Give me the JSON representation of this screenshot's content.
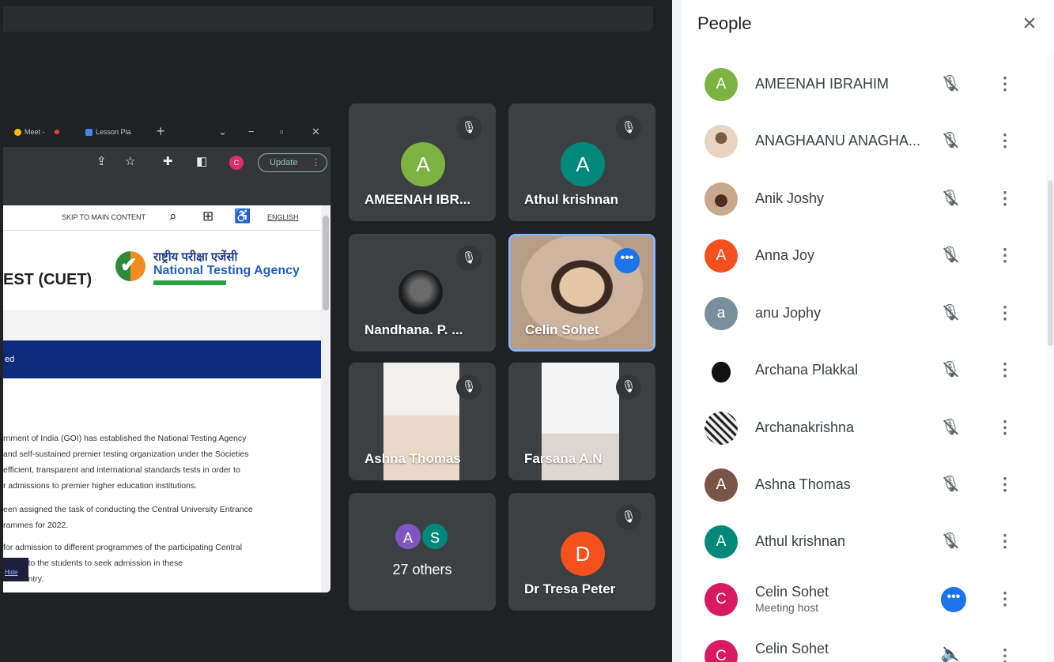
{
  "colors": {
    "meet_bg": "#202124",
    "tile_bg": "#3c4043",
    "accent_blue": "#1a73e8",
    "speaking_border": "#8ab4f8"
  },
  "shared_screen": {
    "browser": {
      "tabs": [
        "Meet -",
        "Lesson Pla"
      ],
      "new_tab_icon": "plus-icon",
      "update_label": "Update",
      "profile_initial": "C"
    },
    "site": {
      "skip_link": "SKIP TO MAIN CONTENT",
      "english_link": "ENGLISH",
      "title_fragment": "EST (CUET)",
      "agency_hindi": "राष्ट्रीय परीक्षा एजेंसी",
      "agency_name": "National Testing Agency",
      "banner_fragment": "ed",
      "paragraphs": [
        "rnment of India (GOI) has established the National Testing Agency\n and self-sustained premier testing organization under the Societies\nefficient, transparent and international standards tests in order to\nr admissions to premier higher education institutions.",
        "een assigned the task of conducting the Central University Entrance\nrammes for 2022.",
        " for admission to different programmes of the participating Central\n      rtunity to the students to seek admission in these\n      ne country."
      ],
      "hide_label": "Hide"
    }
  },
  "tiles": [
    {
      "name": "AMEENAH IBR...",
      "initial": "A",
      "color": "#7cb342",
      "muted": true
    },
    {
      "name": "Athul krishnan",
      "initial": "A",
      "color": "#00897b",
      "muted": true
    },
    {
      "name": "Nandhana. P. ...",
      "muted": true
    },
    {
      "name": "Celin Sohet",
      "speaking": true
    },
    {
      "name": "Ashna Thomas",
      "muted": true
    },
    {
      "name": "Farsana A.N",
      "muted": true
    },
    {
      "others_label": "27 others",
      "initials": [
        "A",
        "S"
      ],
      "colors": [
        "#7e57c2",
        "#00897b"
      ]
    },
    {
      "name": "Dr Tresa Peter",
      "initial": "D",
      "color": "#f4511e",
      "muted": true
    }
  ],
  "people_panel": {
    "title": "People",
    "close_icon": "close-icon",
    "participants": [
      {
        "name": "AMEENAH IBRAHIM",
        "initial": "A",
        "color": "#7cb342",
        "status": "muted"
      },
      {
        "name": "ANAGHAANU ANAGHA...",
        "photo": true,
        "color": "#e8d4c0",
        "status": "muted"
      },
      {
        "name": "Anik Joshy",
        "photo": true,
        "color": "#c9a98e",
        "status": "muted"
      },
      {
        "name": "Anna Joy",
        "initial": "A",
        "color": "#f4511e",
        "status": "muted"
      },
      {
        "name": "anu Jophy",
        "initial": "a",
        "color": "#78909c",
        "status": "muted"
      },
      {
        "name": "Archana Plakkal",
        "photo": true,
        "color": "#222222",
        "status": "muted"
      },
      {
        "name": "Archanakrishna",
        "photo": true,
        "color": "#eeeeee",
        "status": "muted"
      },
      {
        "name": "Ashna Thomas",
        "initial": "A",
        "color": "#795548",
        "status": "muted"
      },
      {
        "name": "Athul krishnan",
        "initial": "A",
        "color": "#00897b",
        "status": "muted"
      },
      {
        "name": "Celin Sohet",
        "subtitle": "Meeting host",
        "initial": "C",
        "color": "#d81b60",
        "status": "speaking"
      },
      {
        "name": "Celin Sohet",
        "initial": "C",
        "color": "#d81b60",
        "status": "presenting"
      }
    ]
  }
}
